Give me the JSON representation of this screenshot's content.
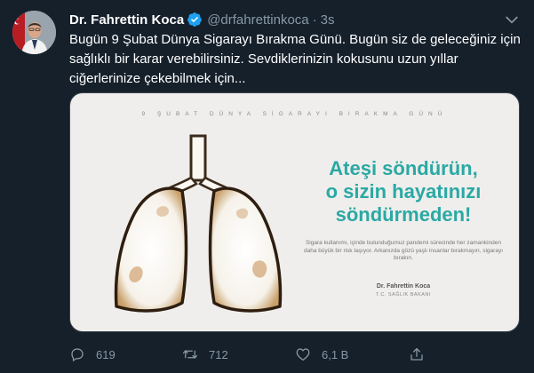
{
  "tweet": {
    "author_name": "Dr. Fahrettin Koca",
    "handle": "@drfahrettinkoca",
    "separator": "·",
    "time": "3s",
    "text": "Bugün 9 Şubat Dünya Sigarayı Bırakma Günü. Bugün siz de geleceğiniz için sağlıklı bir karar verebilirsiniz. Sevdiklerinizin kokusunu uzun yıllar ciğerlerinize çekebilmek için..."
  },
  "media": {
    "header": "9 ŞUBAT DÜNYA SİGARAYI BIRAKMA GÜNÜ",
    "headline_line1": "Ateşi söndürün,",
    "headline_line2": "o sizin hayatınızı",
    "headline_line3": "söndürmeden!",
    "body": "Sigara kullanımı, içinde bulunduğumuz pandemi sürecinde her zamankinden daha büyük bir risk taşıyor. Arkanızda gözü yaşlı insanlar bırakmayın, sigarayı bırakın.",
    "signature_name": "Dr. Fahrettin Koca",
    "signature_title": "T.C. SAĞLIK BAKANI"
  },
  "actions": {
    "replies": "619",
    "retweets": "712",
    "likes": "6,1 B"
  },
  "colors": {
    "background": "#15202b",
    "secondary_text": "#8899a6",
    "verified_blue": "#1da1f2",
    "headline_teal": "#2aa9a4"
  },
  "icons": [
    "verified-badge-icon",
    "chevron-down-icon",
    "reply-icon",
    "retweet-icon",
    "like-icon",
    "share-icon"
  ]
}
